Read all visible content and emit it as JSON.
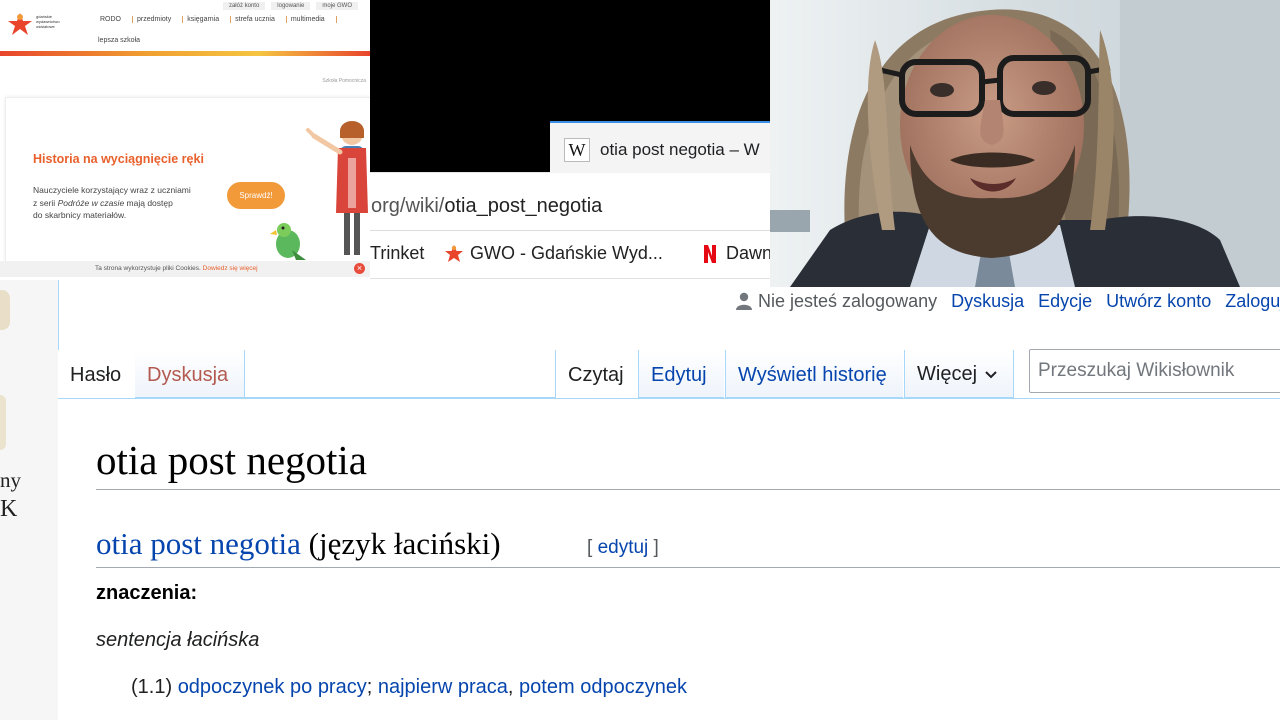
{
  "gwo": {
    "logo_text": "gdańskie wydawnictwo oświatowe",
    "top_links": [
      "załóż konto",
      "logowanie",
      "moje GWO"
    ],
    "nav": [
      "RODO",
      "przedmioty",
      "księgarnia",
      "strefa ucznia",
      "multimedia"
    ],
    "nav2": "lepsza szkoła",
    "small_text": "Szkoła Pomocnicza",
    "headline": "Historia na wyciągnięcie ręki",
    "para_l1": "Nauczyciele korzystający wraz z uczniami",
    "para_l2_pre": "z serii ",
    "para_l2_em": "Podróże w czasie",
    "para_l2_post": " mają dostęp",
    "para_l3": "do skarbnicy materiałów.",
    "button": "Sprawdź!",
    "cookie_msg": "Ta strona wykorzystuje pliki Cookies. ",
    "cookie_more": "Dowiedz się więcej"
  },
  "browser": {
    "tab_icon": "W",
    "tab_title": "otia post negotia – W",
    "url_prefix": "org/wiki/",
    "url_path": "otia_post_negotia",
    "bookmarks": [
      "Trinket",
      "GWO - Gdańskie Wyd...",
      "Dawn"
    ]
  },
  "wiki": {
    "left_fragments": [
      "ny",
      "K"
    ],
    "personal": {
      "not_logged": "Nie jesteś zalogowany",
      "links": [
        "Dyskusja",
        "Edycje",
        "Utwórz konto",
        "Zaloguj"
      ]
    },
    "tabs": {
      "haslo": "Hasło",
      "dyskusja": "Dyskusja",
      "czytaj": "Czytaj",
      "edytuj": "Edytuj",
      "historia": "Wyświetl historię",
      "wiecej": "Więcej"
    },
    "search_placeholder": "Przeszukaj Wikisłownik",
    "title": "otia post negotia",
    "section_link": "otia post negotia",
    "section_lang": " (język łaciński)",
    "edit_open": "[ ",
    "edit_label": "edytuj",
    "edit_close": " ]",
    "meanings_label": "znaczenia:",
    "sentence": "sentencja łacińska",
    "def_num": "(1.1) ",
    "def_link1": "odpoczynek",
    "def_sp1": " ",
    "def_link2": "po",
    "def_sp2": " ",
    "def_link3": "pracy",
    "def_sep": "; ",
    "def_link4": "najpierw",
    "def_sp3": " ",
    "def_link5": "praca",
    "def_sep2": ", ",
    "def_link6": "potem",
    "def_sp4": " ",
    "def_link7": "odpoczynek"
  },
  "colors": {
    "wiki_link": "#0645ad",
    "gwo_orange": "#e8602c",
    "tab_accent": "#3a8ee6"
  }
}
